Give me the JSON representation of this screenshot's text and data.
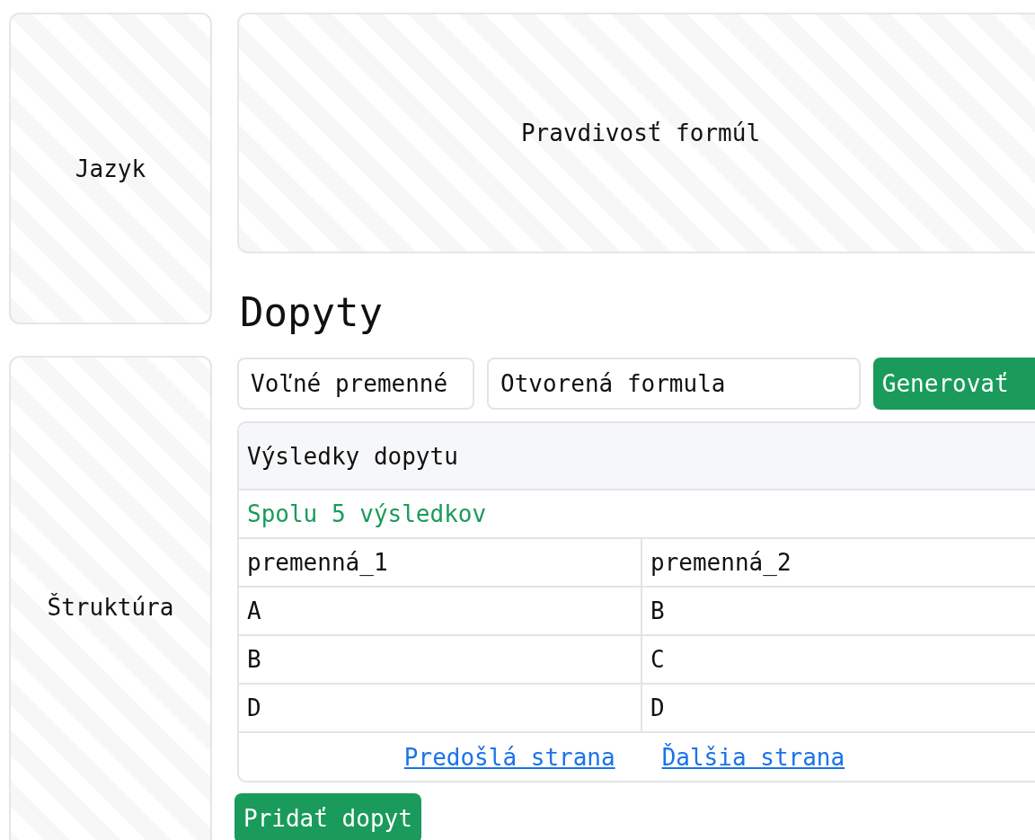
{
  "side_panels": [
    {
      "label": "Jazyk"
    },
    {
      "label": "Štruktúra"
    }
  ],
  "hero_panel": {
    "label": "Pravdivosť formúl"
  },
  "section_title": "Dopyty",
  "query": {
    "variables": {
      "value": "Voľné premenné"
    },
    "formula": {
      "value": "Otvorená formula"
    },
    "button": "Generovať"
  },
  "results": {
    "title": "Výsledky dopytu",
    "count": "Spolu 5 výsledkov",
    "columns": [
      "premenná_1",
      "premenná_2"
    ],
    "rows": [
      [
        "A",
        "B"
      ],
      [
        "B",
        "C"
      ],
      [
        "D",
        "D"
      ]
    ],
    "pagination": [
      "Predošlá strana",
      "Ďalšia strana"
    ]
  },
  "add_button": "Pridať dopyt"
}
